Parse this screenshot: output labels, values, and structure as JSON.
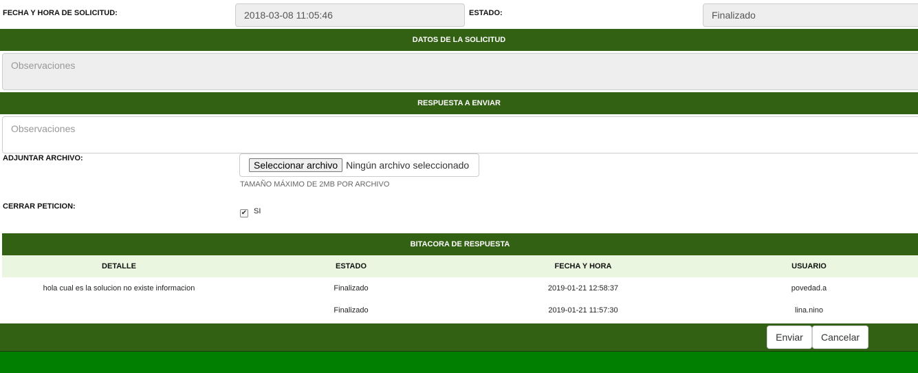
{
  "request": {
    "date_label": "FECHA Y HORA DE SOLICITUD:",
    "date_value": "2018-03-08 11:05:46",
    "status_label": "ESTADO:",
    "status_value": "Finalizado"
  },
  "sections": {
    "datos": "DATOS DE LA SOLICITUD",
    "respuesta": "RESPUESTA A ENVIAR",
    "bitacora": "BITACORA DE RESPUESTA"
  },
  "datos_observaciones": {
    "placeholder": "Observaciones"
  },
  "respuesta_observaciones": {
    "placeholder": "Observaciones"
  },
  "attachment": {
    "label": "ADJUNTAR ARCHIVO:",
    "button": "Seleccionar archivo",
    "status": "Ningún archivo seleccionado",
    "help": "TAMAÑO MÁXIMO DE 2MB POR ARCHIVO"
  },
  "close_request": {
    "label": "CERRAR PETICION:",
    "checkbox_label": "SI",
    "checked": true
  },
  "log_table": {
    "headers": [
      "DETALLE",
      "ESTADO",
      "FECHA Y HORA",
      "USUARIO"
    ],
    "rows": [
      [
        "hola cual es la solucion no existe informacion",
        "Finalizado",
        "2019-01-21 12:58:37",
        "povedad.a"
      ],
      [
        "",
        "Finalizado",
        "2019-01-21 11:57:30",
        "lina.nino"
      ]
    ]
  },
  "actions": {
    "send": "Enviar",
    "cancel": "Cancelar"
  },
  "colors": {
    "band": "#336114",
    "table_header": "#eaf6e0",
    "bottom_bar": "#007f00"
  }
}
